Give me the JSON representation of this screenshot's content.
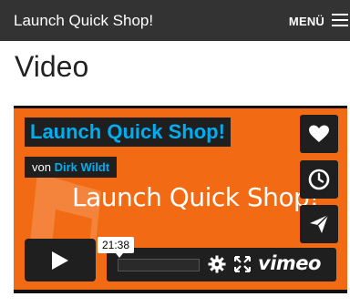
{
  "header": {
    "site_title": "Launch Quick Shop!",
    "menu_label": "MENÜ"
  },
  "page": {
    "title": "Video"
  },
  "video": {
    "title": "Launch Quick Shop!",
    "byline_prefix": "von",
    "author": "Dirk Wildt",
    "poster_text": "Launch Quick Shop!",
    "time": "21:38",
    "brand": "vimeo",
    "progress_percent": 0,
    "icons": [
      "heart-icon",
      "clock-icon",
      "paper-plane-icon",
      "play-icon",
      "settings-icon",
      "fullscreen-icon"
    ],
    "colors": {
      "accent": "#00adef",
      "poster_background": "#f26b14",
      "controls": "#1f1f1f"
    }
  }
}
